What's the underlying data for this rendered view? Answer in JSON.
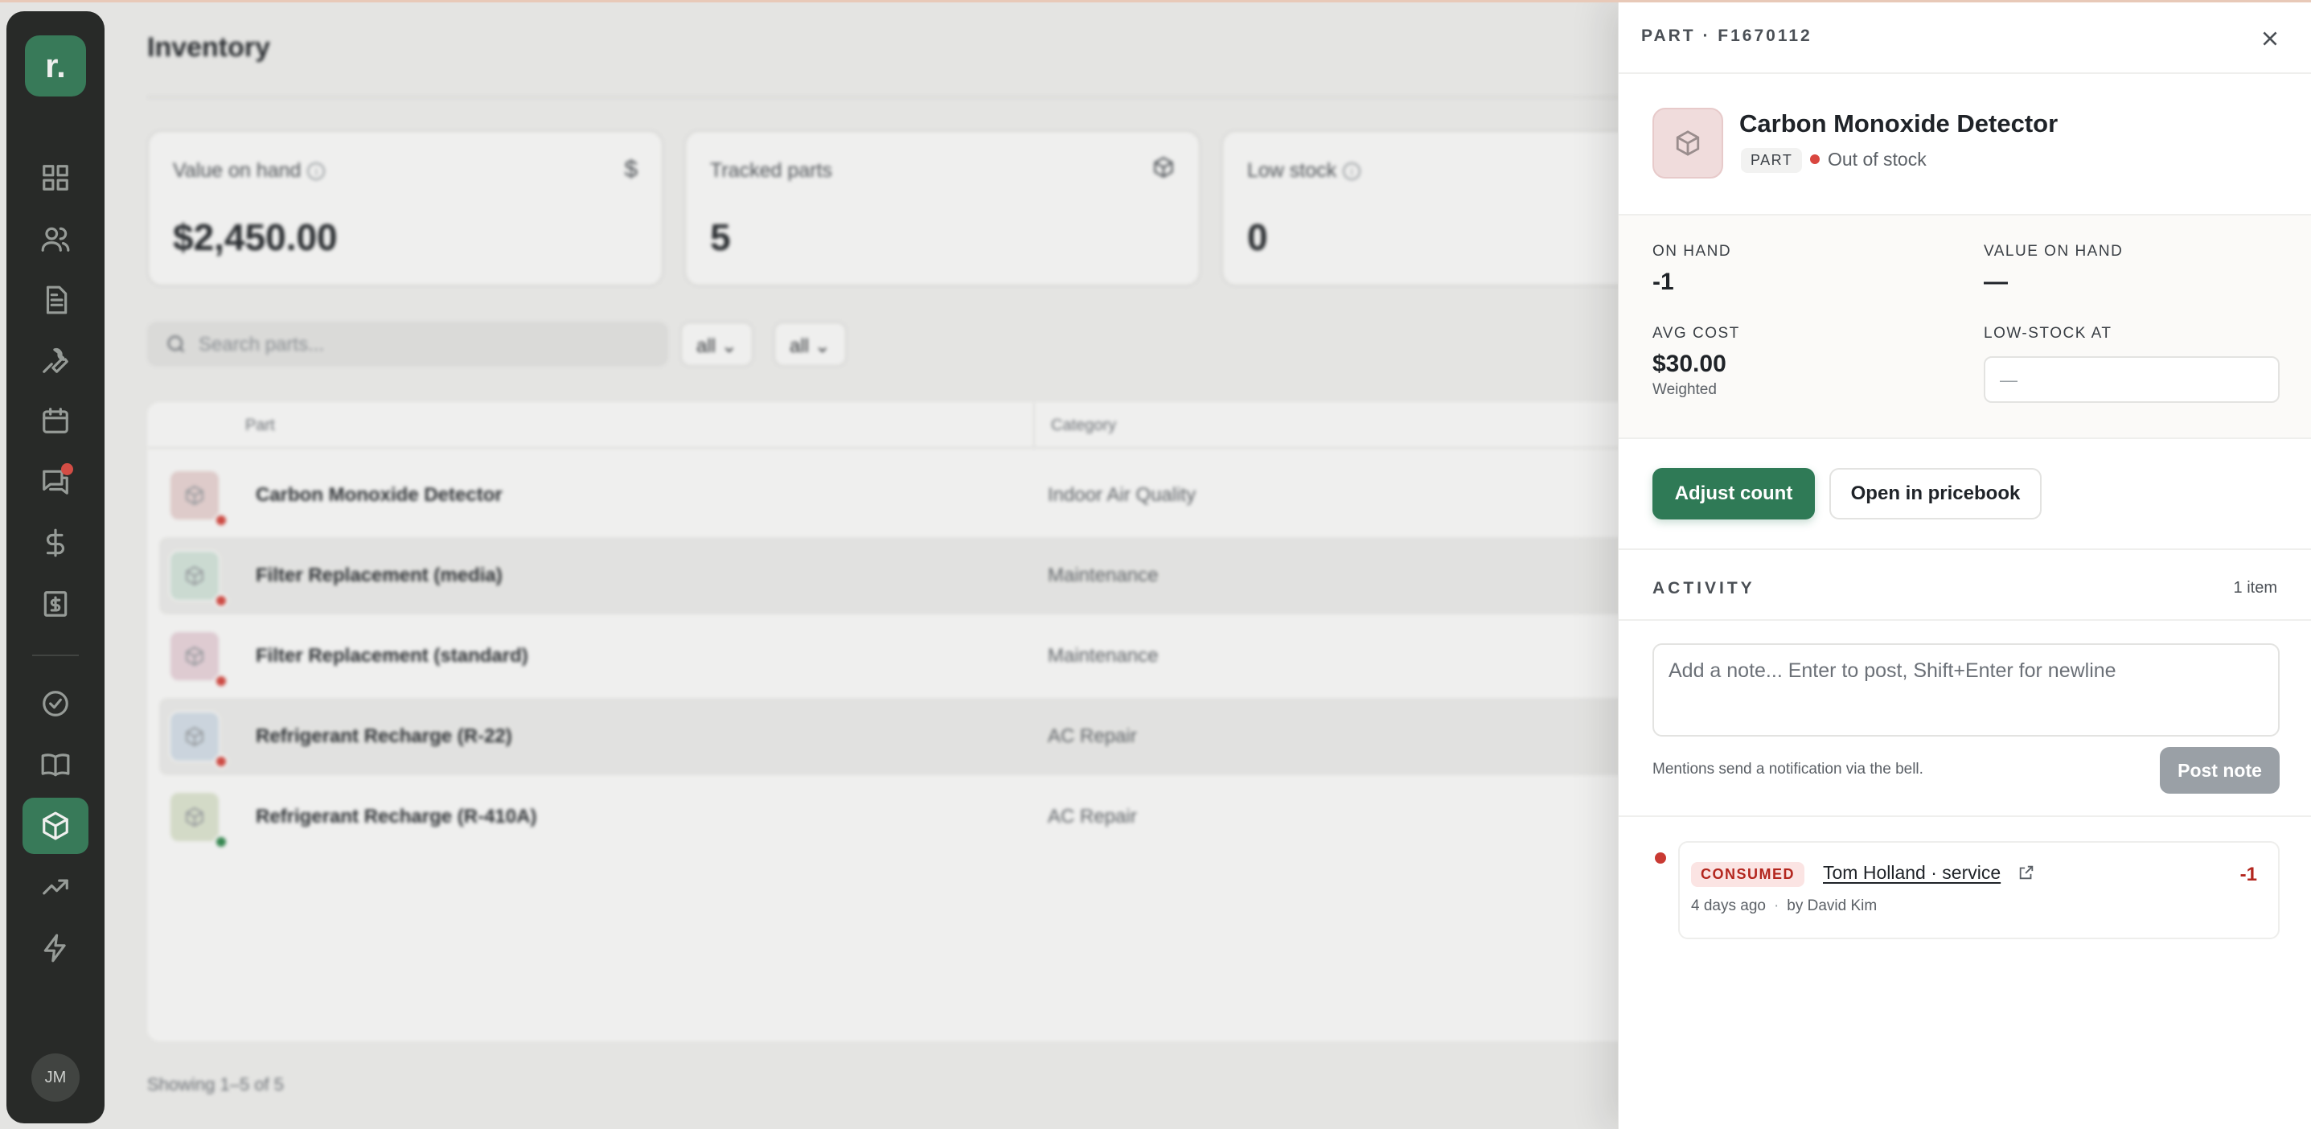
{
  "sidebar": {
    "logo": "r.",
    "items": [
      {
        "icon": "grid-icon"
      },
      {
        "icon": "users-icon"
      },
      {
        "icon": "document-icon"
      },
      {
        "icon": "wrench-icon"
      },
      {
        "icon": "calendar-icon"
      },
      {
        "icon": "chat-icon",
        "has_notification": true
      },
      {
        "icon": "dollar-icon"
      },
      {
        "icon": "invoice-icon"
      },
      {
        "icon": "check-circle-icon"
      },
      {
        "icon": "book-icon"
      },
      {
        "icon": "box-icon",
        "active": true
      },
      {
        "icon": "trend-icon"
      },
      {
        "icon": "bolt-icon"
      }
    ],
    "avatar_initials": "JM"
  },
  "inventory": {
    "title": "Inventory",
    "stats": [
      {
        "label": "Value on hand",
        "value": "$2,450.00",
        "icon": "dollar-icon",
        "info": true
      },
      {
        "label": "Tracked parts",
        "value": "5",
        "icon": "box-icon",
        "info": false
      },
      {
        "label": "Low stock",
        "value": "0",
        "icon": "",
        "info": true
      }
    ],
    "search_placeholder": "Search parts...",
    "filters": [
      "all",
      "all"
    ],
    "columns": {
      "part": "Part",
      "category": "Category"
    },
    "rows": [
      {
        "name": "Carbon Monoxide Detector",
        "category": "Indoor Air Quality",
        "thumb_color": "#ecd6d6",
        "status_color": "#d9463f"
      },
      {
        "name": "Filter Replacement (media)",
        "category": "Maintenance",
        "thumb_color": "#d6e8df",
        "status_color": "#d9463f"
      },
      {
        "name": "Filter Replacement (standard)",
        "category": "Maintenance",
        "thumb_color": "#ecd6df",
        "status_color": "#d9463f"
      },
      {
        "name": "Refrigerant Recharge (R-22)",
        "category": "AC Repair",
        "thumb_color": "#d6e1ec",
        "status_color": "#d9463f"
      },
      {
        "name": "Refrigerant Recharge (R-410A)",
        "category": "AC Repair",
        "thumb_color": "#e0e8d3",
        "status_color": "#2f8a4e"
      }
    ],
    "showing": "Showing 1–5 of 5"
  },
  "drawer": {
    "header": "PART · F1670112",
    "part_name": "Carbon Monoxide Detector",
    "type_badge": "PART",
    "stock_status": "Out of stock",
    "on_hand_label": "ON HAND",
    "on_hand_value": "-1",
    "value_on_hand_label": "VALUE ON HAND",
    "value_on_hand_value": "—",
    "avg_cost_label": "AVG COST",
    "avg_cost_value": "$30.00",
    "avg_cost_sub": "Weighted",
    "low_stock_label": "LOW-STOCK AT",
    "low_stock_placeholder": "—",
    "adjust_button": "Adjust count",
    "pricebook_button": "Open in pricebook",
    "activity_title": "ACTIVITY",
    "activity_count": "1 item",
    "note_placeholder": "Add a note... Enter to post, Shift+Enter for newline",
    "mentions_hint": "Mentions send a notification via the bell.",
    "post_button": "Post note",
    "activity": [
      {
        "tag": "CONSUMED",
        "link": "Tom Holland · service",
        "delta": "-1",
        "when": "4 days ago",
        "by": "by David Kim"
      }
    ],
    "accent_color": "#2f7a56",
    "danger_color": "#b3261e"
  }
}
